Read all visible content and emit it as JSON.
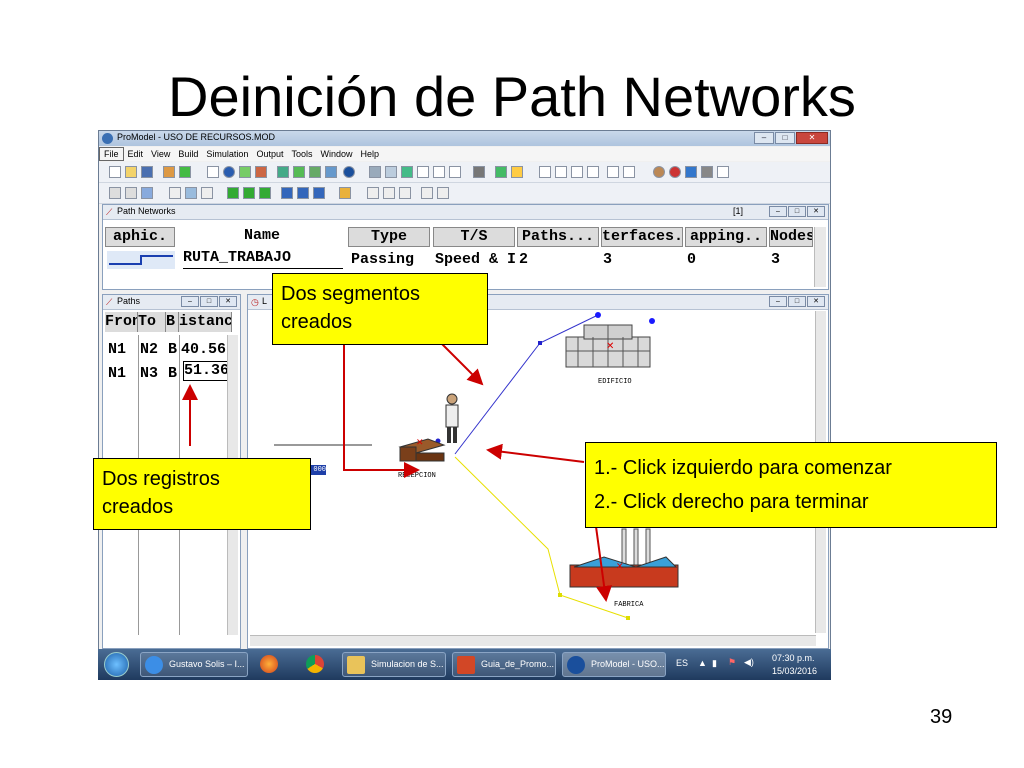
{
  "slide": {
    "title": "Deinición de Path Networks",
    "number": "39"
  },
  "app": {
    "title": "ProModel - USO DE RECURSOS.MOD",
    "menu": [
      "File",
      "Edit",
      "View",
      "Build",
      "Simulation",
      "Output",
      "Tools",
      "Window",
      "Help"
    ]
  },
  "path_networks": {
    "title": "Path Networks",
    "index": "[1]",
    "columns": [
      "aphic.",
      "Name",
      "Type",
      "T/S",
      "Paths...",
      "terfaces.",
      "apping..",
      "Nodes"
    ],
    "row": {
      "name": "RUTA_TRABAJO",
      "type": "Passing",
      "ts": "Speed & I",
      "paths": "2",
      "interfaces": "3",
      "mapping": "0",
      "nodes": "3"
    }
  },
  "paths": {
    "title": "Paths",
    "columns": [
      "Fron",
      "To",
      "B.",
      "istanc"
    ],
    "rows": [
      {
        "from": "N1",
        "to": "N2",
        "b": "B",
        "dist": "40.56"
      },
      {
        "from": "N1",
        "to": "N3",
        "b": "B",
        "dist": "51.36"
      }
    ]
  },
  "layout_window": {
    "title": "L",
    "labels": {
      "edificio": "EDIFICIO",
      "recepcion": "RECEPCION",
      "fabrica": "FABRICA"
    },
    "counter": "000"
  },
  "callouts": {
    "segments": [
      "Dos segmentos",
      "creados"
    ],
    "records": [
      "Dos registros",
      "creados"
    ],
    "instructions": [
      "1.- Click izquierdo para comenzar",
      "2.- Click derecho para terminar"
    ]
  },
  "taskbar": {
    "buttons": [
      "Gustavo Solis – I...",
      "Simulacion de S...",
      "Guia_de_Promo...",
      "ProModel - USO..."
    ],
    "lang": "ES",
    "time": "07:30 p.m.",
    "date": "15/03/2016"
  },
  "colors": {
    "callout": "#ffff00",
    "arrow": "#cc0000",
    "path_blue": "#3333cc",
    "path_yellow": "#e8e000"
  }
}
